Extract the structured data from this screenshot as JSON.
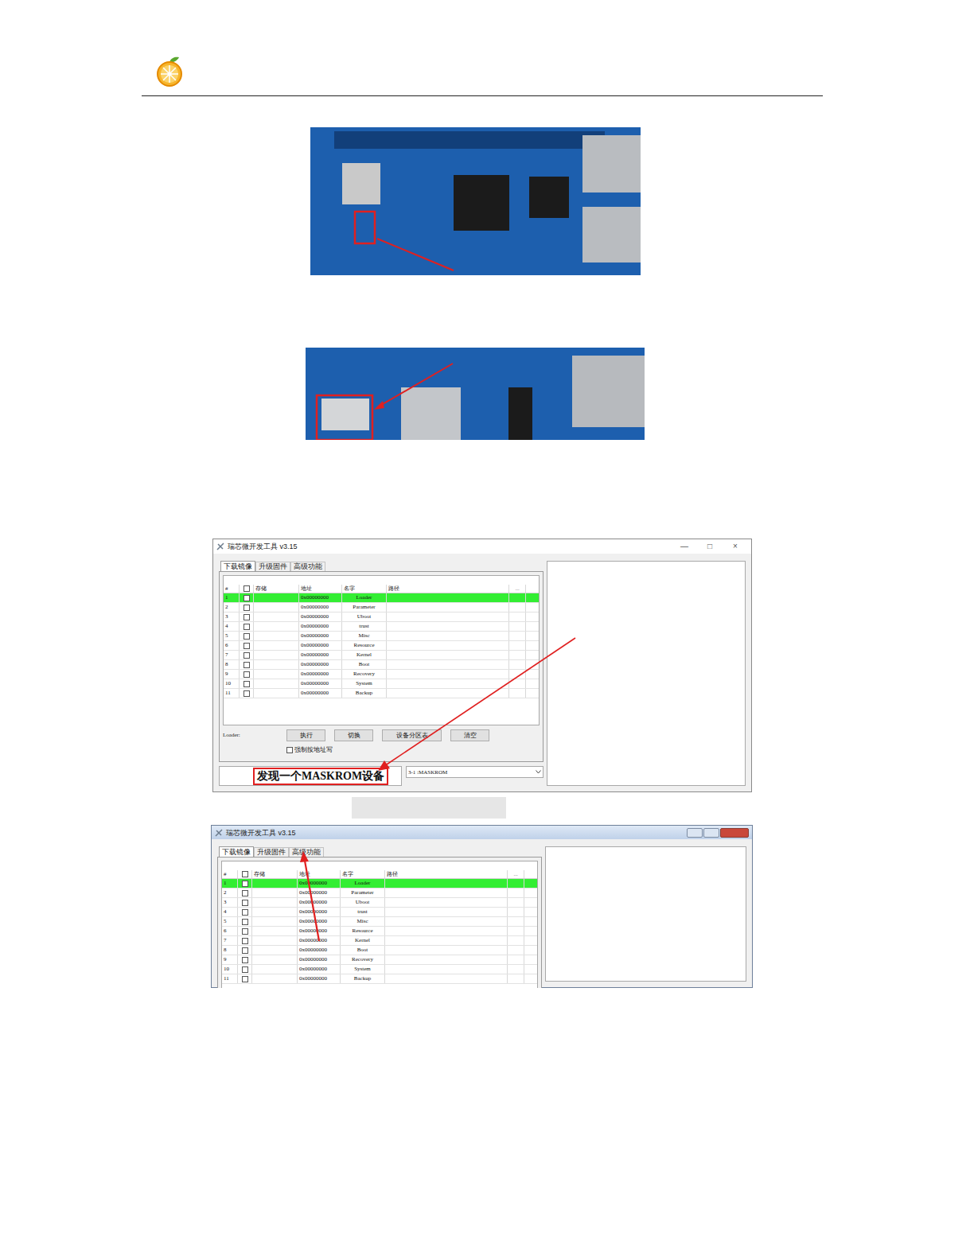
{
  "screenshots": [
    {
      "kind": "modern",
      "title": "瑞芯微开发工具 v3.15",
      "controls": [
        "—",
        "□",
        "×"
      ],
      "tabs": [
        {
          "label": "下载镜像",
          "selected": true
        },
        {
          "label": "升级固件",
          "selected": false
        },
        {
          "label": "高级功能",
          "selected": false
        }
      ],
      "columns": [
        {
          "kind": "text",
          "label": "#"
        },
        {
          "kind": "checkbox",
          "checked": false
        },
        {
          "kind": "text",
          "label": "存储"
        },
        {
          "kind": "text",
          "label": "地址"
        },
        {
          "kind": "text",
          "label": "名字"
        },
        {
          "kind": "text",
          "label": "路径"
        },
        {
          "kind": "text",
          "label": "..."
        }
      ],
      "rows": [
        {
          "index": "1",
          "checked": false,
          "address": "0x00000000",
          "name": "Loader",
          "selected": true
        },
        {
          "index": "2",
          "checked": false,
          "address": "0x00000000",
          "name": "Parameter",
          "selected": false
        },
        {
          "index": "3",
          "checked": false,
          "address": "0x00000000",
          "name": "Uboot",
          "selected": false
        },
        {
          "index": "4",
          "checked": false,
          "address": "0x00000000",
          "name": "trust",
          "selected": false
        },
        {
          "index": "5",
          "checked": false,
          "address": "0x00000000",
          "name": "Misc",
          "selected": false
        },
        {
          "index": "6",
          "checked": false,
          "address": "0x00000000",
          "name": "Resource",
          "selected": false
        },
        {
          "index": "7",
          "checked": false,
          "address": "0x00000000",
          "name": "Kernel",
          "selected": false
        },
        {
          "index": "8",
          "checked": false,
          "address": "0x00000000",
          "name": "Boot",
          "selected": false
        },
        {
          "index": "9",
          "checked": false,
          "address": "0x00000000",
          "name": "Recovery",
          "selected": false
        },
        {
          "index": "10",
          "checked": false,
          "address": "0x00000000",
          "name": "System",
          "selected": false
        },
        {
          "index": "11",
          "checked": false,
          "address": "0x00000000",
          "name": "Backup",
          "selected": false
        }
      ],
      "loader_label": "Loader:",
      "buttons": [
        "执行",
        "切换",
        "设备分区表",
        "清空"
      ],
      "force_write": {
        "label": "强制按地址写",
        "checked": false
      },
      "status": "发现一个MASKROM设备",
      "device": "3-1 :MASKROM"
    },
    {
      "kind": "classic",
      "title": "瑞芯微开发工具 v3.15",
      "tabs": [
        {
          "label": "下载镜像",
          "selected": true
        },
        {
          "label": "升级固件",
          "selected": false
        },
        {
          "label": "高级功能",
          "selected": false
        }
      ],
      "columns": [
        {
          "kind": "text",
          "label": "#"
        },
        {
          "kind": "checkbox",
          "checked": false
        },
        {
          "kind": "text",
          "label": "存储"
        },
        {
          "kind": "text",
          "label": "地址"
        },
        {
          "kind": "text",
          "label": "名字"
        },
        {
          "kind": "text",
          "label": "路径"
        },
        {
          "kind": "text",
          "label": "..."
        }
      ],
      "rows": [
        {
          "index": "1",
          "checked": false,
          "address": "0x00000000",
          "name": "Loader",
          "selected": true
        },
        {
          "index": "2",
          "checked": false,
          "address": "0x00000000",
          "name": "Parameter",
          "selected": false
        },
        {
          "index": "3",
          "checked": false,
          "address": "0x00000000",
          "name": "Uboot",
          "selected": false
        },
        {
          "index": "4",
          "checked": false,
          "address": "0x00000000",
          "name": "trust",
          "selected": false
        },
        {
          "index": "5",
          "checked": false,
          "address": "0x00000000",
          "name": "Misc",
          "selected": false
        },
        {
          "index": "6",
          "checked": false,
          "address": "0x00000000",
          "name": "Resource",
          "selected": false
        },
        {
          "index": "7",
          "checked": false,
          "address": "0x00000000",
          "name": "Kernel",
          "selected": false
        },
        {
          "index": "8",
          "checked": false,
          "address": "0x00000000",
          "name": "Boot",
          "selected": false
        },
        {
          "index": "9",
          "checked": false,
          "address": "0x00000000",
          "name": "Recovery",
          "selected": false
        },
        {
          "index": "10",
          "checked": false,
          "address": "0x00000000",
          "name": "System",
          "selected": false
        },
        {
          "index": "11",
          "checked": false,
          "address": "0x00000000",
          "name": "Backup",
          "selected": false
        }
      ]
    }
  ]
}
